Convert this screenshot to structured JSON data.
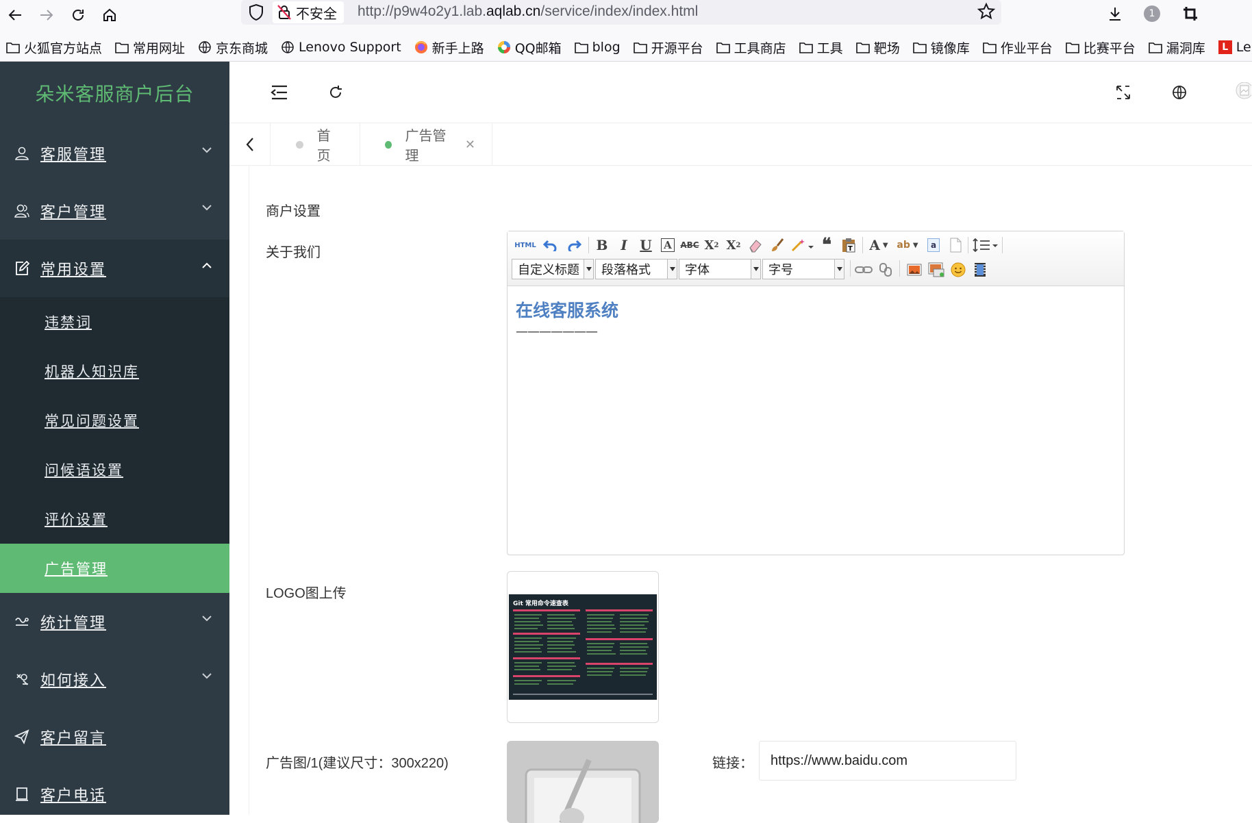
{
  "browser": {
    "security_label": "不安全",
    "url_prefix": "http://p9w4o2y1.lab.",
    "url_domain": "aqlab.cn",
    "url_suffix": "/service/index/index.html",
    "notification_count": "1",
    "bookmarks": [
      {
        "label": "火狐官方站点",
        "icon": "folder-icon"
      },
      {
        "label": "常用网址",
        "icon": "folder-icon"
      },
      {
        "label": "京东商城",
        "icon": "globe-icon"
      },
      {
        "label": "Lenovo Support",
        "icon": "globe-icon"
      },
      {
        "label": "新手上路",
        "icon": "firefox-icon"
      },
      {
        "label": "QQ邮箱",
        "icon": "qq-mail-icon"
      },
      {
        "label": "blog",
        "icon": "folder-icon"
      },
      {
        "label": "开源平台",
        "icon": "folder-icon"
      },
      {
        "label": "工具商店",
        "icon": "folder-icon"
      },
      {
        "label": "工具",
        "icon": "folder-icon"
      },
      {
        "label": "靶场",
        "icon": "folder-icon"
      },
      {
        "label": "镜像库",
        "icon": "folder-icon"
      },
      {
        "label": "作业平台",
        "icon": "folder-icon"
      },
      {
        "label": "比赛平台",
        "icon": "folder-icon"
      },
      {
        "label": "漏洞库",
        "icon": "folder-icon"
      },
      {
        "label": "Leno",
        "icon": "lenovo-icon",
        "badge": "L"
      }
    ]
  },
  "sidebar": {
    "brand": "朵米客服商户后台",
    "menus": [
      {
        "label": "客服管理",
        "icon": "user-icon",
        "open": false
      },
      {
        "label": "客户管理",
        "icon": "users-icon",
        "open": false
      },
      {
        "label": "常用设置",
        "icon": "edit-icon",
        "open": true
      }
    ],
    "submenus": [
      {
        "label": "违禁词",
        "active": false
      },
      {
        "label": "机器人知识库",
        "active": false
      },
      {
        "label": "常见问题设置",
        "active": false
      },
      {
        "label": "问候语设置",
        "active": false
      },
      {
        "label": "评价设置",
        "active": false
      },
      {
        "label": "广告管理",
        "active": true
      }
    ],
    "menus_after": [
      {
        "label": "统计管理",
        "icon": "chart-icon",
        "has_chevron": true
      },
      {
        "label": "如何接入",
        "icon": "plug-icon",
        "has_chevron": true
      },
      {
        "label": "客户留言",
        "icon": "message-icon",
        "has_chevron": false
      },
      {
        "label": "客户电话",
        "icon": "phone-icon",
        "has_chevron": false
      }
    ]
  },
  "tabs": [
    {
      "label": "首页",
      "active": false,
      "closable": false
    },
    {
      "label": "广告管理",
      "active": true,
      "closable": true
    }
  ],
  "form": {
    "section_title": "商户设置",
    "about_label": "关于我们",
    "logo_label": "LOGO图上传",
    "ad_label": "广告图/1(建议尺寸：300x220)",
    "link_label": "链接：",
    "link_value": "https://www.baidu.com"
  },
  "editor": {
    "html_button": "HTML",
    "combos": [
      "自定义标题",
      "段落格式",
      "字体",
      "字号"
    ],
    "content_title": "在线客服系统",
    "content_sub": "———————"
  },
  "logo_preview": {
    "title": "Git 常用命令速查表"
  },
  "colors": {
    "sidebar_bg": "#2e3b44",
    "sidebar_sub_bg": "#1f2a31",
    "accent_green": "#5fba73",
    "editor_title": "#4f80c2"
  }
}
